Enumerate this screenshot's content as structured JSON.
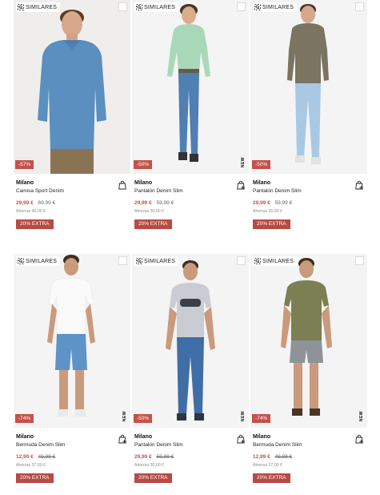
{
  "colors": {
    "accent": "#c4524a",
    "extra_badge": "#b84a44"
  },
  "products": [
    {
      "similares": "SIMILARES",
      "discount": "-57%",
      "new_badge": "",
      "brand": "Milano",
      "name": "Camisa Sport Denim",
      "sale_price": "29,99 €",
      "original_price": "69,99 €",
      "original_struck": false,
      "savings": "Ahorras 40,00 €",
      "extra": "20% EXTRA",
      "icon": "bag-icon"
    },
    {
      "similares": "SIMILARES",
      "discount": "-50%",
      "new_badge": "NEW",
      "brand": "Milano",
      "name": "Pantalón Denim Slim",
      "sale_price": "29,99 €",
      "original_price": "59,99 €",
      "original_struck": false,
      "savings": "Ahorras 30,00 €",
      "extra": "20% EXTRA",
      "icon": "bag-plus-icon"
    },
    {
      "similares": "SIMILARES",
      "discount": "-50%",
      "new_badge": "",
      "brand": "Milano",
      "name": "Pantalón Denim Slim",
      "sale_price": "29,99 €",
      "original_price": "59,99 €",
      "original_struck": false,
      "savings": "Ahorras 30,00 €",
      "extra": "20% EXTRA",
      "icon": "bag-plus-icon"
    },
    {
      "similares": "SIMILARES",
      "discount": "-74%",
      "new_badge": "NEW",
      "brand": "Milano",
      "name": "Bermuda Denim Slim",
      "sale_price": "12,99 €",
      "original_price": "49,99 €",
      "original_struck": true,
      "savings": "Ahorras 37,00 €",
      "extra": "20% EXTRA",
      "icon": "bag-plus-icon"
    },
    {
      "similares": "SIMILARES",
      "discount": "-50%",
      "new_badge": "NEW",
      "brand": "Milano",
      "name": "Pantalón Denim Slim",
      "sale_price": "29,99 €",
      "original_price": "59,99 €",
      "original_struck": true,
      "savings": "Ahorras 30,00 €",
      "extra": "20% EXTRA",
      "icon": "bag-plus-icon"
    },
    {
      "similares": "SIMILARES",
      "discount": "-74%",
      "new_badge": "NEW",
      "brand": "Milano",
      "name": "Bermuda Denim Slim",
      "sale_price": "12,99 €",
      "original_price": "49,99 €",
      "original_struck": true,
      "savings": "Ahorras 37,00 €",
      "extra": "20% EXTRA",
      "icon": "bag-plus-icon"
    }
  ]
}
